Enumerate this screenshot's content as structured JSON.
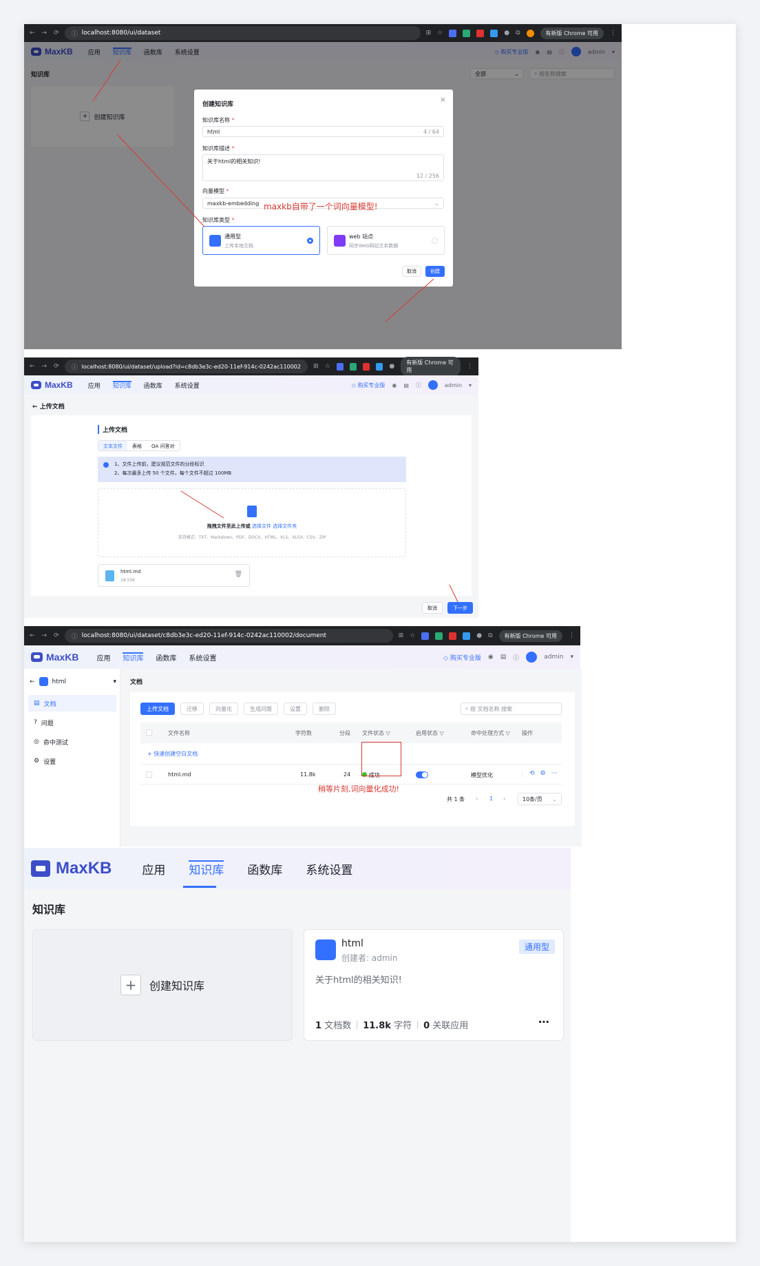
{
  "s1": {
    "url": "localhost:8080/ui/dataset",
    "update": "有新版 Chrome 可用",
    "logo": "MaxKB",
    "menu": [
      "应用",
      "知识库",
      "函数库",
      "系统设置"
    ],
    "buy": "购买专业版",
    "user": "admin",
    "page_title": "知识库",
    "filter_value": "全部",
    "search_placeholder": "按名称搜索",
    "create_card": "创建知识库",
    "dialog": {
      "title": "创建知识库",
      "name_label": "知识库名称",
      "name_value": "html",
      "name_count": "4 / 64",
      "desc_label": "知识库描述",
      "desc_value": "关于html的相关知识!",
      "desc_count": "12 / 256",
      "model_label": "向量模型",
      "model_value": "maxkb-embedding",
      "type_label": "知识库类型",
      "type1_title": "通用型",
      "type1_sub": "上传本地文档",
      "type2_title": "web 站点",
      "type2_sub": "同步Web网站文本数据",
      "cancel": "取消",
      "create": "创建"
    },
    "annotation": "maxkb自带了一个词向量模型!"
  },
  "s2": {
    "url": "localhost:8080/ui/dataset/upload?id=c8db3e3c-ed20-11ef-914c-0242ac110002",
    "update": "有新版 Chrome 可用",
    "back_title": "上传文档",
    "section_title": "上传文档",
    "tabs": [
      "文本文件",
      "表格",
      "QA 问答对"
    ],
    "tips": [
      "1、文件上传前，建议规范文件的分段标识",
      "2、每次最多上传 50 个文件，每个文件不超过 100MB"
    ],
    "drop_text": "拖拽文件至此上传或",
    "choose_file": "选择文件",
    "choose_folder": "选择文件夹",
    "formats": "支持格式：TXT、Markdown、PDF、DOCX、HTML、XLS、XLSX、CSV、ZIP",
    "file_name": "html.md",
    "file_size": "18.55K",
    "cancel": "取消",
    "next": "下一步"
  },
  "s3": {
    "url": "localhost:8080/ui/dataset/c8db3e3c-ed20-11ef-914c-0242ac110002/document",
    "update": "有新版 Chrome 可用",
    "kb_name": "html",
    "side": [
      "文档",
      "问题",
      "命中测试",
      "设置"
    ],
    "title": "文档",
    "buttons": [
      "上传文档",
      "迁移",
      "向量化",
      "生成问题",
      "设置",
      "删除"
    ],
    "search_placeholder": "按 文档名称 搜索",
    "cols": [
      "文件名称",
      "字符数",
      "分段",
      "文件状态",
      "启用状态",
      "命中处理方式",
      "操作"
    ],
    "add_blank": "+ 快速创建空白文档",
    "row": {
      "name": "html.md",
      "chars": "11.8k",
      "segments": "24",
      "status": "成功",
      "hit": "模型优化"
    },
    "total": "共 1 条",
    "page": "1",
    "page_size": "10条/页",
    "annotation": "稍等片刻,词向量化成功!"
  },
  "s4": {
    "logo": "MaxKB",
    "menu": [
      "应用",
      "知识库",
      "函数库",
      "系统设置"
    ],
    "page_title": "知识库",
    "create_card": "创建知识库",
    "kb": {
      "name": "html",
      "creator": "创建者: admin",
      "badge": "通用型",
      "desc": "关于html的相关知识!",
      "docs_num": "1",
      "docs_label": "文档数",
      "chars_num": "11.8k",
      "chars_label": "字符",
      "apps_num": "0",
      "apps_label": "关联应用"
    }
  },
  "colors": {
    "primary": "#3370ff",
    "brand": "#3d4ec8",
    "annotation": "#d83931",
    "success": "#34c724"
  }
}
